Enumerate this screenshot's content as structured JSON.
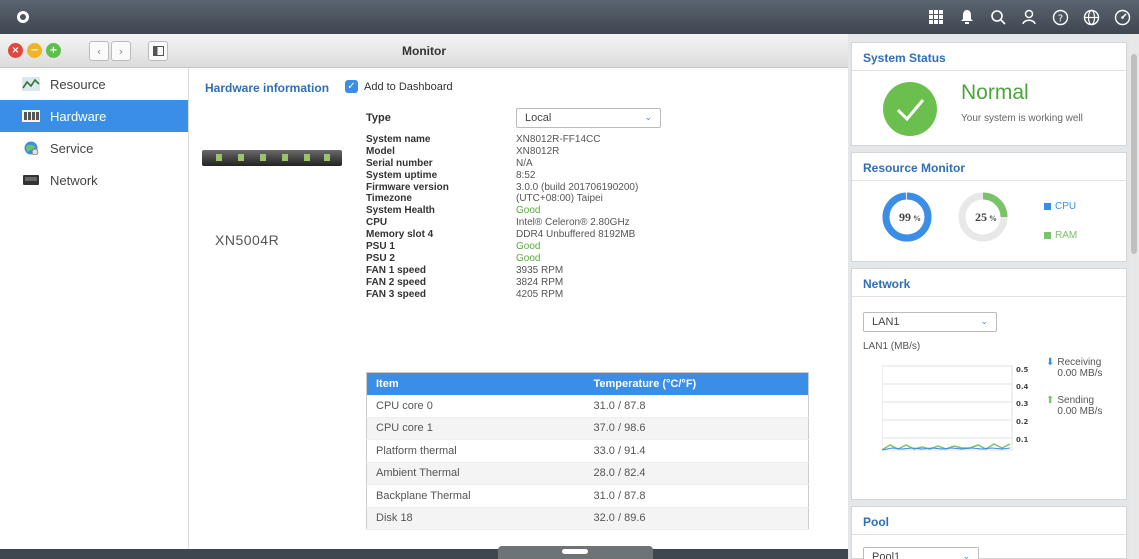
{
  "window": {
    "title": "Monitor"
  },
  "sidebar": {
    "items": [
      {
        "label": "Resource",
        "icon": "chart-icon"
      },
      {
        "label": "Hardware",
        "icon": "server-icon"
      },
      {
        "label": "Service",
        "icon": "globe-icon"
      },
      {
        "label": "Network",
        "icon": "network-icon"
      }
    ],
    "active": "Hardware"
  },
  "hardware": {
    "section_title": "Hardware information",
    "add_dashboard_label": "Add to Dashboard",
    "add_dashboard_checked": true,
    "model": "XN5004R",
    "type_label": "Type",
    "type_value": "Local",
    "info": [
      {
        "k": "System name",
        "v": "XN8012R-FF14CC",
        "good": false
      },
      {
        "k": "Model",
        "v": "XN8012R",
        "good": false
      },
      {
        "k": "Serial number",
        "v": "N/A",
        "good": false
      },
      {
        "k": "System uptime",
        "v": "8:52",
        "good": false
      },
      {
        "k": "Firmware version",
        "v": "3.0.0 (build 201706190200)",
        "good": false
      },
      {
        "k": "Timezone",
        "v": "(UTC+08:00) Taipei",
        "good": false
      },
      {
        "k": "System Health",
        "v": "Good",
        "good": true
      },
      {
        "k": "CPU",
        "v": "Intel® Celeron® 2.80GHz",
        "good": false
      },
      {
        "k": "Memory slot 4",
        "v": "DDR4 Unbuffered 8192MB",
        "good": false
      },
      {
        "k": "PSU 1",
        "v": "Good",
        "good": true
      },
      {
        "k": "PSU 2",
        "v": "Good",
        "good": true
      },
      {
        "k": "FAN 1 speed",
        "v": "3935 RPM",
        "good": false
      },
      {
        "k": "FAN 2 speed",
        "v": "3824 RPM",
        "good": false
      },
      {
        "k": "FAN 3 speed",
        "v": "4205 RPM",
        "good": false
      }
    ],
    "temp_table": {
      "headers": [
        "Item",
        "Temperature (°C/°F)"
      ],
      "rows": [
        [
          "CPU core 0",
          "31.0 / 87.8"
        ],
        [
          "CPU core 1",
          "37.0 / 98.6"
        ],
        [
          "Platform thermal",
          "33.0 / 91.4"
        ],
        [
          "Ambient Thermal",
          "28.0 / 82.4"
        ],
        [
          "Backplane Thermal",
          "31.0 / 87.8"
        ],
        [
          "Disk 18",
          "32.0 / 89.6"
        ]
      ]
    }
  },
  "dashboard": {
    "status": {
      "title": "System Status",
      "state": "Normal",
      "message": "Your system is working well",
      "color": "#5aab3e"
    },
    "resource": {
      "title": "Resource Monitor",
      "cpu": {
        "value": 99,
        "text": "99",
        "unit": "%",
        "label": "CPU",
        "color": "#3a8ee6"
      },
      "ram": {
        "value": 25,
        "text": "25",
        "unit": "%",
        "label": "RAM",
        "color": "#7ac36a"
      }
    },
    "network": {
      "title": "Network",
      "selected": "LAN1",
      "unit_label": "LAN1 (MB/s)",
      "ticks": [
        "0.5",
        "0.4",
        "0.3",
        "0.2",
        "0.1"
      ],
      "receiving_label": "Receiving",
      "receiving_value": "0.00 MB/s",
      "sending_label": "Sending",
      "sending_value": "0.00 MB/s"
    },
    "pool": {
      "title": "Pool",
      "selected": "Pool1"
    }
  },
  "topbar_icons": [
    "apps-icon",
    "notification-icon",
    "search-icon",
    "user-icon",
    "help-icon",
    "language-icon",
    "dashboard-icon"
  ]
}
